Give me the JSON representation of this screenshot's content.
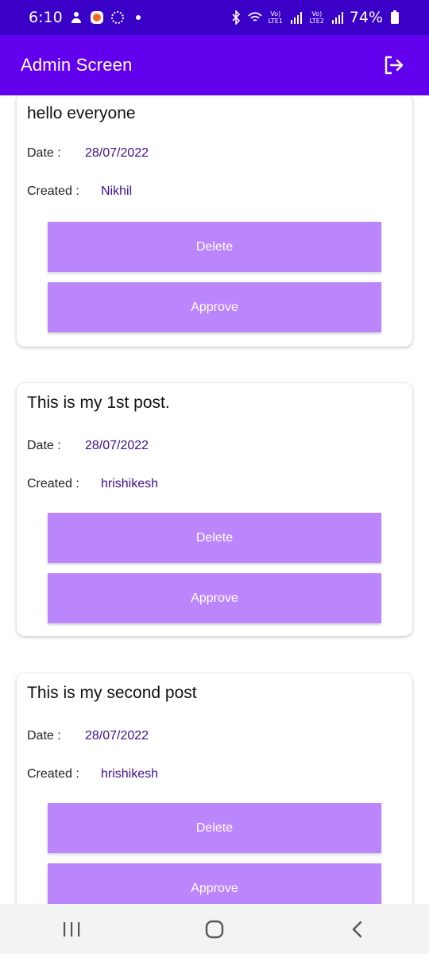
{
  "status_bar": {
    "time": "6:10",
    "battery": "74%",
    "signal_1": "Vo) LTE1",
    "signal_2": "Vo) LTE2",
    "icons": [
      "notification-icon",
      "app-icon",
      "sync-icon",
      "dot-icon",
      "bluetooth-icon",
      "wifi-icon",
      "signal-icon",
      "battery-icon"
    ]
  },
  "app_bar": {
    "title": "Admin Screen",
    "logout_icon": "logout-icon"
  },
  "labels": {
    "date": "Date :",
    "created": "Created :"
  },
  "posts": [
    {
      "title": "hello everyone",
      "date": "28/07/2022",
      "created_by": "Nikhil",
      "delete_label": "Delete",
      "approve_label": "Approve"
    },
    {
      "title": "This is my 1st post.",
      "date": "28/07/2022",
      "created_by": "hrishikesh",
      "delete_label": "Delete",
      "approve_label": "Approve"
    },
    {
      "title": "This is my second post",
      "date": "28/07/2022",
      "created_by": "hrishikesh",
      "delete_label": "Delete",
      "approve_label": "Approve"
    }
  ],
  "colors": {
    "status_bar": "#3b00c8",
    "app_bar": "#6200ee",
    "button": "#bb86fc",
    "value_text": "#3d0f8f"
  },
  "nav_bar": {
    "icons": [
      "recent-apps-icon",
      "home-icon",
      "back-icon"
    ]
  }
}
